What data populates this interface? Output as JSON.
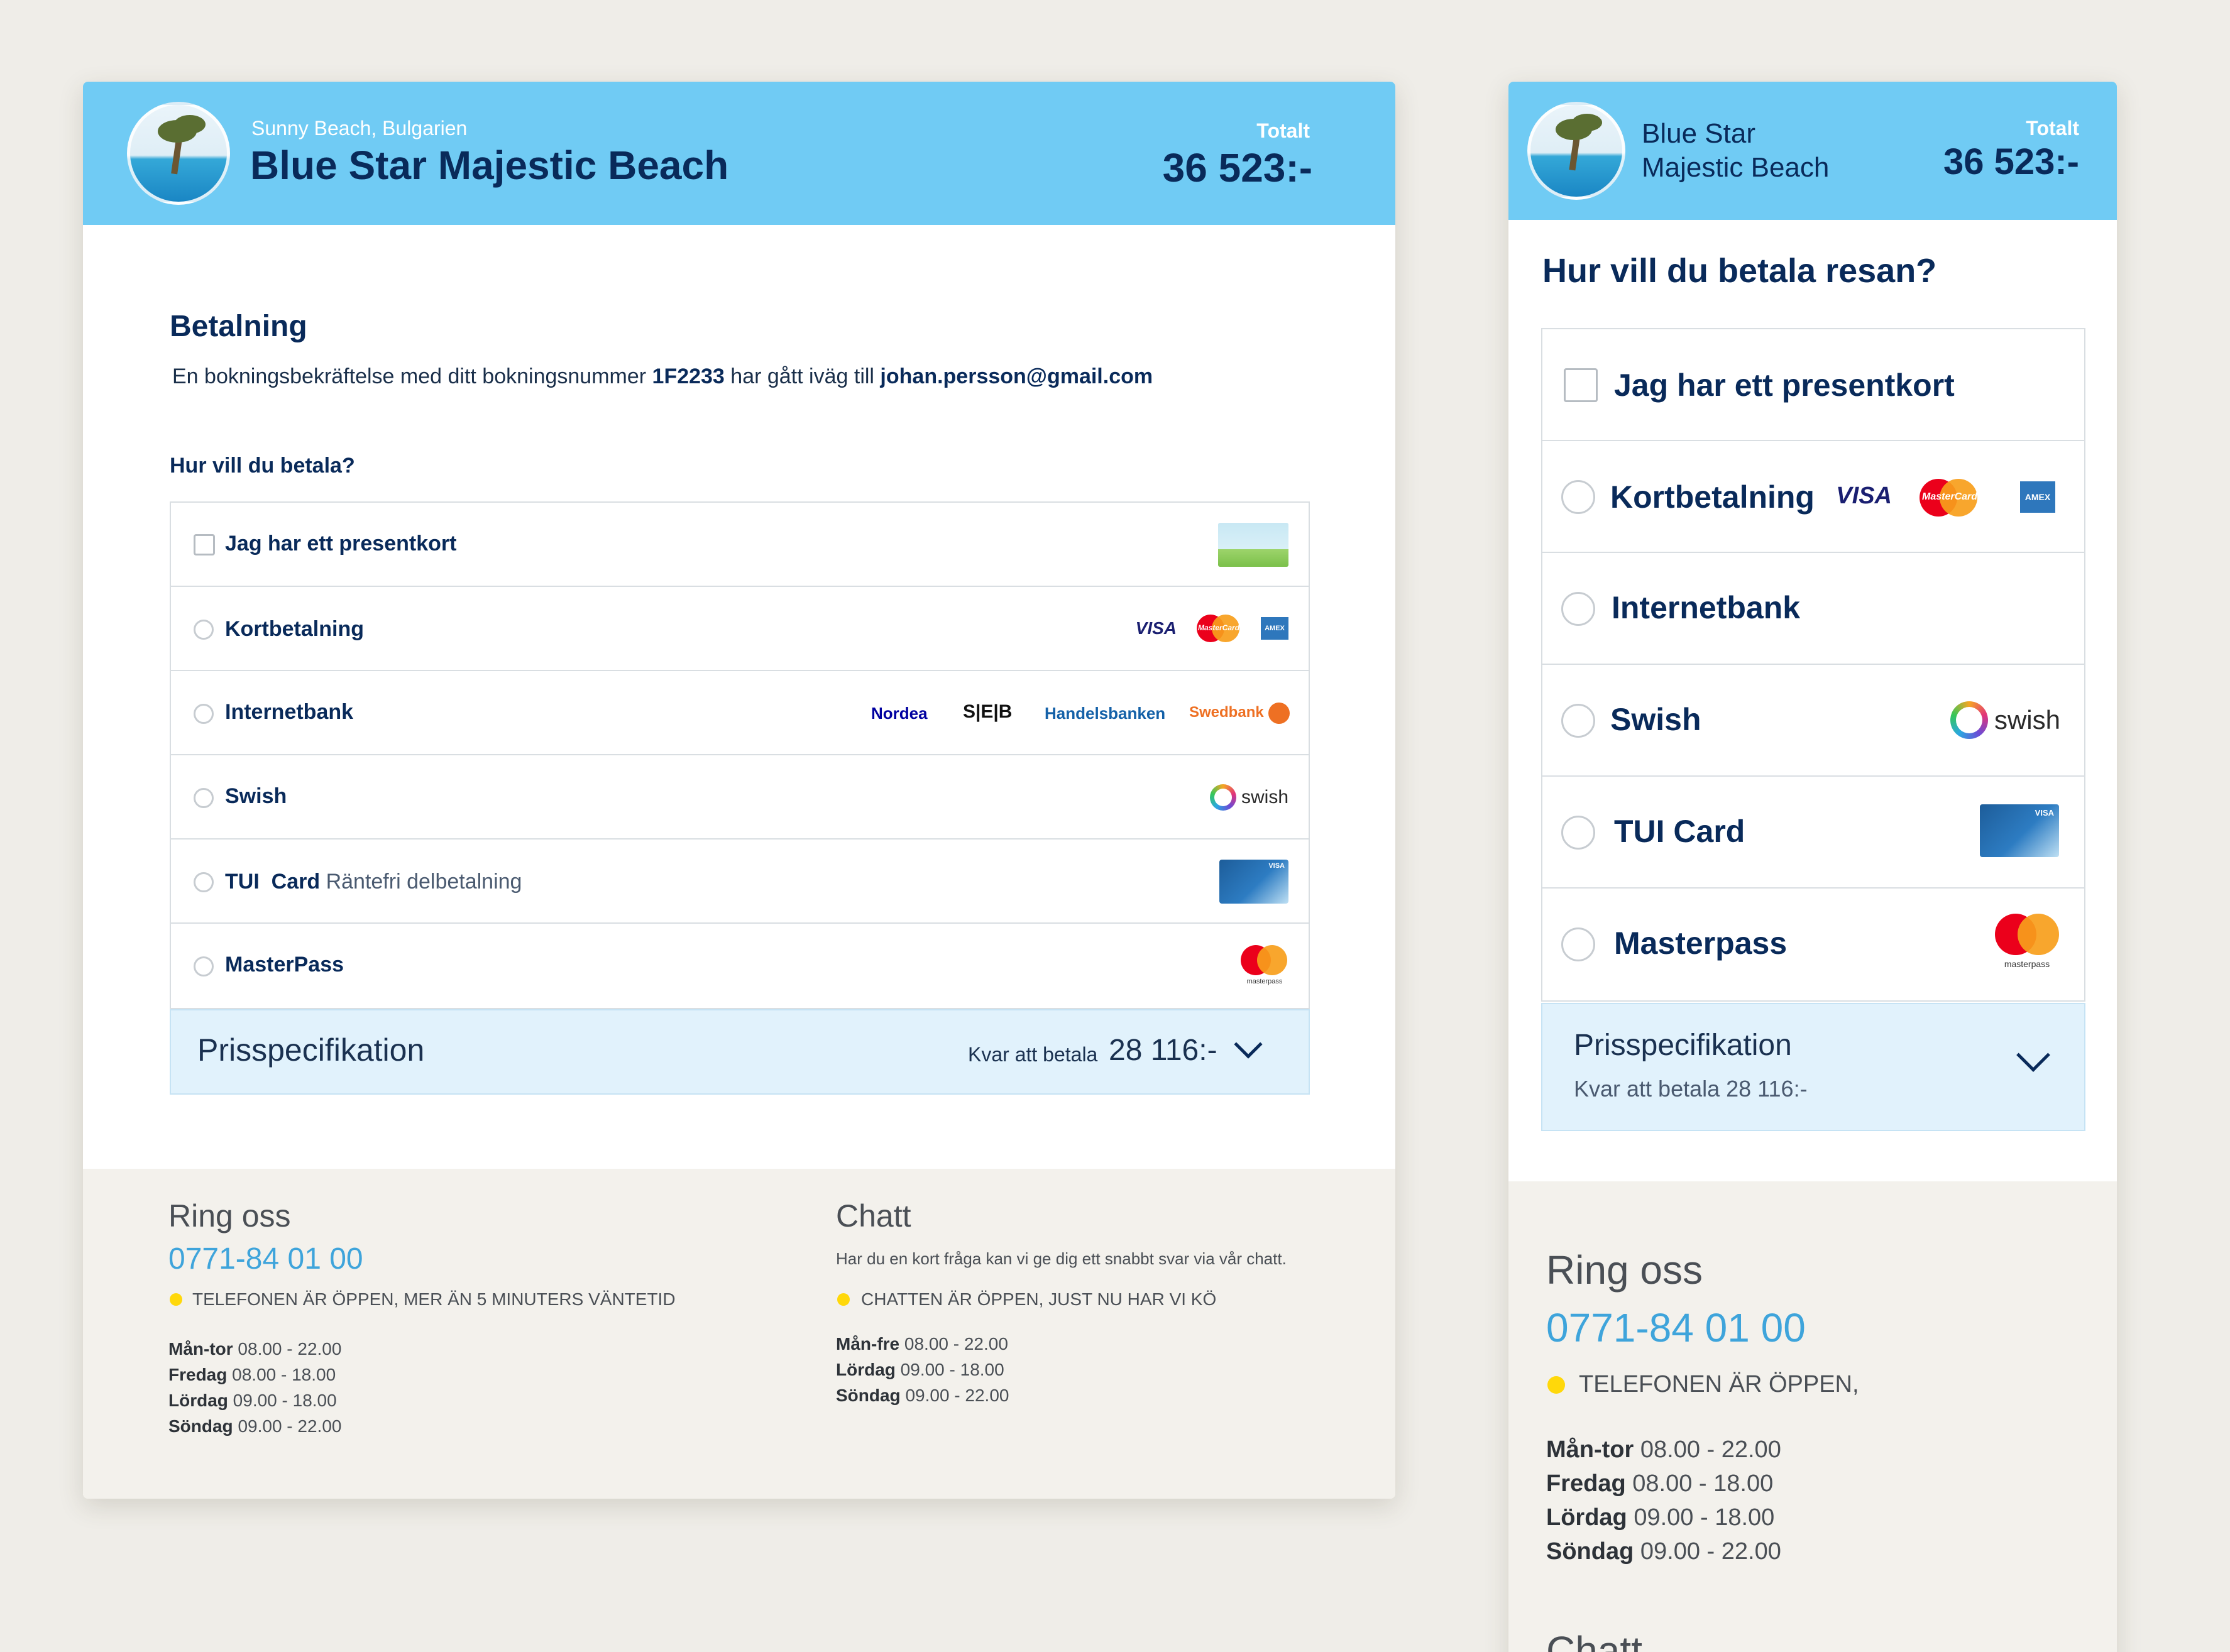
{
  "desktop": {
    "header": {
      "location": "Sunny Beach, Bulgarien",
      "hotel_name": "Blue Star Majestic Beach",
      "total_label": "Totalt",
      "total_value": "36 523:-"
    },
    "payment": {
      "title": "Betalning",
      "confirm_prefix": "En bokningsbekräftelse med ditt bokningsnummer ",
      "booking_number": "1F2233",
      "confirm_middle": " har gått iväg till ",
      "email": "johan.persson@gmail.com",
      "question": "Hur vill du betala?"
    },
    "options": {
      "giftcard": "Jag har ett presentkort",
      "card": "Kortbetalning",
      "internetbank": "Internetbank",
      "swish": "Swish",
      "tuicard": "TUI  Card",
      "tuicard_sub": " Räntefri delbetalning",
      "masterpass": "MasterPass"
    },
    "logos": {
      "visa": "VISA",
      "mastercard": "MasterCard",
      "amex": "AMEX",
      "nordea": "Nordea",
      "seb": "S|E|B",
      "handelsbanken": "Handelsbanken",
      "swedbank": "Swedbank",
      "swish": "swish",
      "masterpass": "masterpass",
      "tui_visa": "VISA"
    },
    "price": {
      "label": "Prisspecifikation",
      "remaining_label": "Kvar att betala",
      "remaining_value": "28 116:-"
    },
    "footer": {
      "call_title": "Ring oss",
      "phone": "0771-84 01 00",
      "phone_status": "TELEFONEN ÄR ÖPPEN, MER ÄN 5 MINUTERS VÄNTETID",
      "phone_hours": [
        {
          "day": "Mån-tor",
          "time": " 08.00 - 22.00"
        },
        {
          "day": "Fredag",
          "time": " 08.00 - 18.00"
        },
        {
          "day": "Lördag",
          "time": " 09.00 - 18.00"
        },
        {
          "day": "Söndag",
          "time": " 09.00 - 22.00"
        }
      ],
      "chat_title": "Chatt",
      "chat_text": "Har du en kort fråga kan vi ge dig ett snabbt svar via vår chatt.",
      "chat_status": "CHATTEN ÄR ÖPPEN, JUST NU HAR VI KÖ",
      "chat_hours": [
        {
          "day": "Mån-fre",
          "time": " 08.00 - 22.00"
        },
        {
          "day": "Lördag",
          "time": " 09.00 - 18.00"
        },
        {
          "day": "Söndag",
          "time": " 09.00 - 22.00"
        }
      ]
    }
  },
  "mobile": {
    "header": {
      "hotel_line1": "Blue Star",
      "hotel_line2": "Majestic Beach",
      "total_label": "Totalt",
      "total_value": "36 523:-"
    },
    "question": "Hur vill du betala resan?",
    "options": {
      "giftcard": "Jag har ett presentkort",
      "card": "Kortbetalning",
      "internetbank": "Internetbank",
      "swish": "Swish",
      "tuicard": "TUI Card",
      "masterpass": "Masterpass"
    },
    "price": {
      "label": "Prisspecifikation",
      "remaining": "Kvar att betala 28 116:-"
    },
    "footer": {
      "call_title": "Ring oss",
      "phone": "0771-84 01 00",
      "phone_status": "TELEFONEN ÄR ÖPPEN,",
      "phone_hours": [
        {
          "day": "Mån-tor",
          "time": " 08.00 - 22.00"
        },
        {
          "day": "Fredag",
          "time": " 08.00 - 18.00"
        },
        {
          "day": "Lördag",
          "time": " 09.00 - 18.00"
        },
        {
          "day": "Söndag",
          "time": " 09.00 - 22.00"
        }
      ],
      "chat_title": "Chatt"
    }
  },
  "colors": {
    "page_bg": "#efede8",
    "header_bg": "#70cbf4",
    "navy": "#092a5a",
    "phone_blue": "#3ea4db",
    "status_dot": "#ffd80a",
    "price_bg": "#e1f2fc",
    "footer_bg": "#f3f1ec"
  }
}
